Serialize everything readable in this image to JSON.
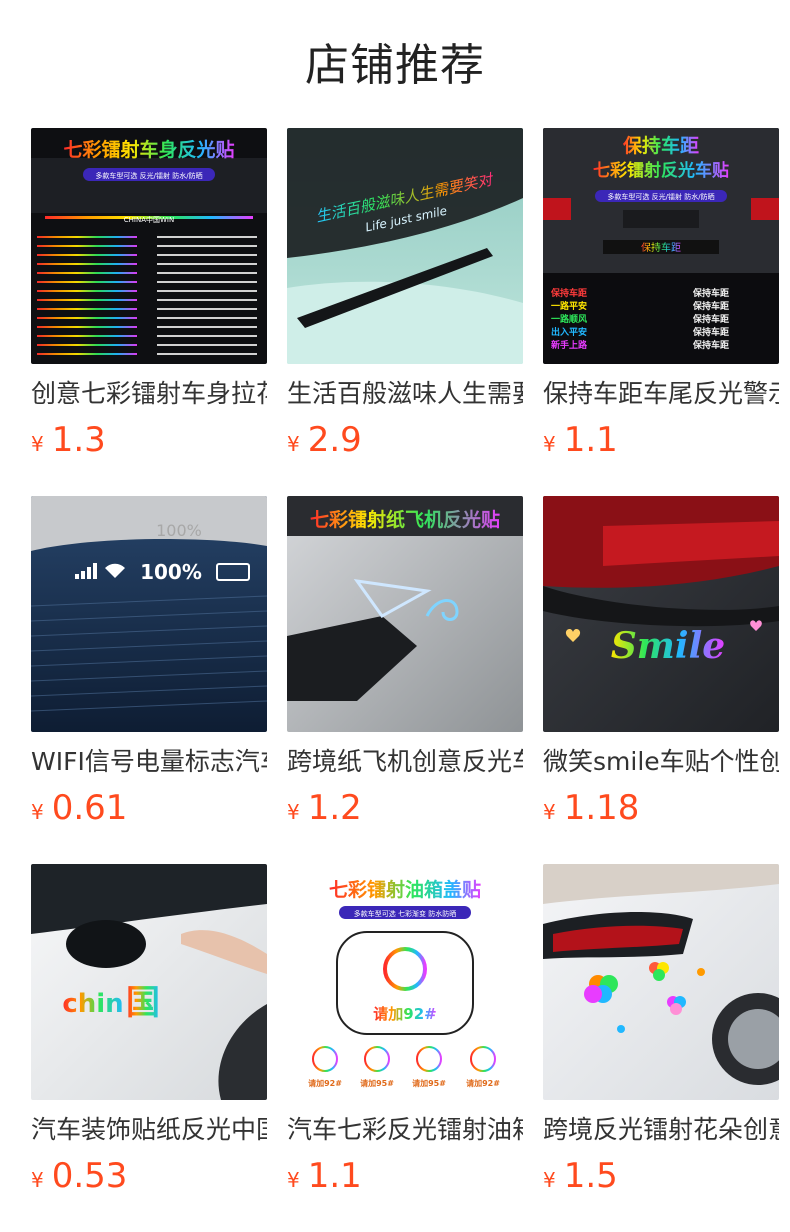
{
  "header": {
    "title": "店铺推荐"
  },
  "currency_symbol": "¥",
  "products": [
    {
      "name": "创意七彩镭射车身拉花车贴",
      "price": "1.3",
      "image_text": {
        "top": "七彩镭射车身反光贴",
        "badge": "多款车型可选 反光/镭射 防水/防晒",
        "stripe": "CHINA中国WIN"
      }
    },
    {
      "name": "生活百般滋味人生需要笑对车贴",
      "price": "2.9",
      "image_text": {
        "top": "生活百般滋味人生需要笑对",
        "sub": "Life just smile"
      }
    },
    {
      "name": "保持车距车尾反光警示贴",
      "price": "1.1",
      "image_text": {
        "top1": "保持车距",
        "top2": "七彩镭射反光车贴",
        "badge": "多款车型可选 反光/镭射 防水/防晒",
        "plate": "保持车距",
        "left_list": [
          "保持车距",
          "一路平安",
          "一路顺风",
          "出入平安",
          "新手上路"
        ],
        "right_list": [
          "保持车距",
          "保持车距",
          "保持车距",
          "保持车距",
          "保持车距"
        ]
      }
    },
    {
      "name": "WIFI信号电量标志汽车贴纸",
      "price": "0.61",
      "image_text": {
        "top": "100%",
        "main": "100%"
      }
    },
    {
      "name": "跨境纸飞机创意反光车贴",
      "price": "1.2",
      "image_text": {
        "top": "七彩镭射纸飞机反光贴"
      }
    },
    {
      "name": "微笑smile车贴个性创意",
      "price": "1.18",
      "image_text": {
        "main": "Smile"
      }
    },
    {
      "name": "汽车装饰贴纸反光中国车贴",
      "price": "0.53",
      "image_text": {
        "main_left": "chin",
        "main_right": "国"
      }
    },
    {
      "name": "汽车七彩反光镭射油箱盖贴",
      "price": "1.1",
      "image_text": {
        "top": "七彩镭射油箱盖贴",
        "badge": "多款车型可选 七彩渐变 防水防晒",
        "center": "请加92#",
        "small": [
          "请加92#",
          "请加95#",
          "请加95#",
          "请加92#"
        ]
      }
    },
    {
      "name": "跨境反光镭射花朵创意车贴",
      "price": "1.5",
      "image_text": {}
    }
  ],
  "colors": {
    "price": "#ff4a1e",
    "title": "#222222",
    "name": "#333333",
    "rainbow": [
      "#ff2a2a",
      "#ff9a00",
      "#ffe600",
      "#2ee65a",
      "#21b8ff",
      "#6a4dff",
      "#e83cff"
    ]
  }
}
